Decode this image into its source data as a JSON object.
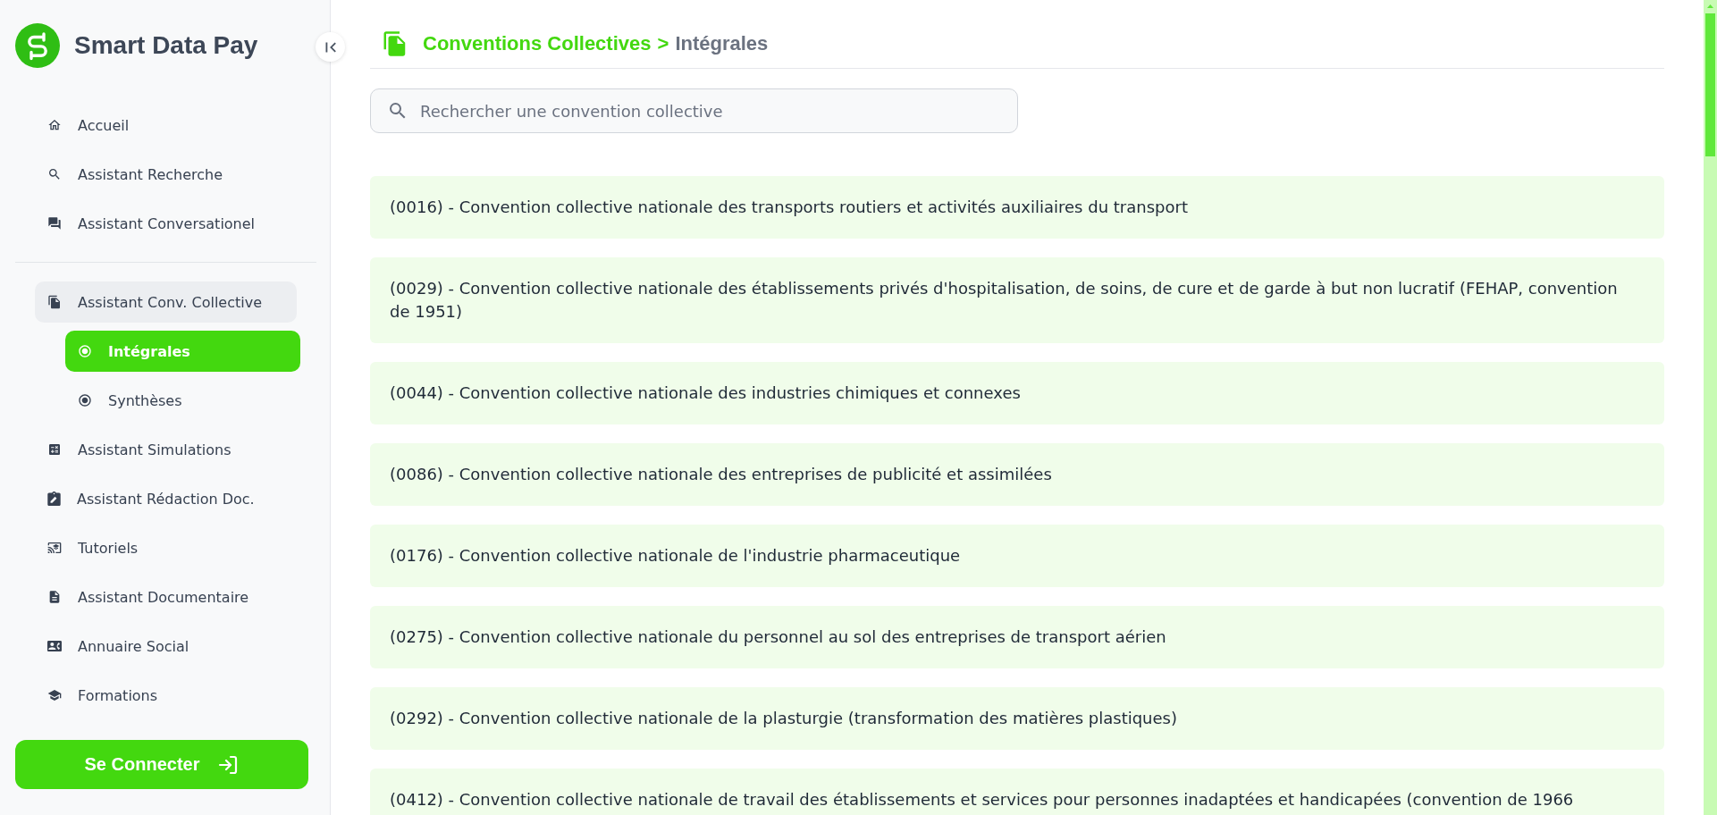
{
  "brand": {
    "name": "Smart Data Pay"
  },
  "sidebar": {
    "sections": [
      {
        "items": [
          {
            "label": "Accueil",
            "selected": false
          },
          {
            "label": "Assistant Recherche",
            "selected": false
          },
          {
            "label": "Assistant Conversationel",
            "selected": false
          }
        ]
      },
      {
        "items": [
          {
            "label": "Assistant Conv. Collective",
            "selected": false,
            "expanded": true,
            "children": [
              {
                "label": "Intégrales",
                "selected": true
              },
              {
                "label": "Synthèses",
                "selected": false
              }
            ]
          },
          {
            "label": "Assistant Simulations",
            "selected": false
          },
          {
            "label": "Assistant Rédaction Doc.",
            "selected": false
          },
          {
            "label": "Tutoriels",
            "selected": false
          },
          {
            "label": "Assistant Documentaire",
            "selected": false
          },
          {
            "label": "Annuaire Social",
            "selected": false
          },
          {
            "label": "Formations",
            "selected": false
          }
        ]
      }
    ],
    "login_button": {
      "label": "Se Connecter"
    }
  },
  "header": {
    "breadcrumb": {
      "parent": "Conventions Collectives",
      "separator": ">",
      "current": "Intégrales"
    }
  },
  "search": {
    "placeholder": "Rechercher une convention collective"
  },
  "conventions": [
    {
      "text": "(0016) - Convention collective nationale des transports routiers et activités auxiliaires du transport"
    },
    {
      "text": "(0029) - Convention collective nationale des établissements privés d'hospitalisation, de soins, de cure et de garde à but non lucratif (FEHAP, convention de 1951)"
    },
    {
      "text": "(0044) - Convention collective nationale des industries chimiques et connexes"
    },
    {
      "text": "(0086) - Convention collective nationale des entreprises de publicité et assimilées"
    },
    {
      "text": "(0176) - Convention collective nationale de l'industrie pharmaceutique"
    },
    {
      "text": "(0275) - Convention collective nationale du personnel au sol des entreprises de transport aérien"
    },
    {
      "text": "(0292) - Convention collective nationale de la plasturgie (transformation des matières plastiques)"
    },
    {
      "text": "(0412) - Convention collective nationale de travail des établissements et services pour personnes inadaptées et handicapées (convention de 1966"
    }
  ]
}
